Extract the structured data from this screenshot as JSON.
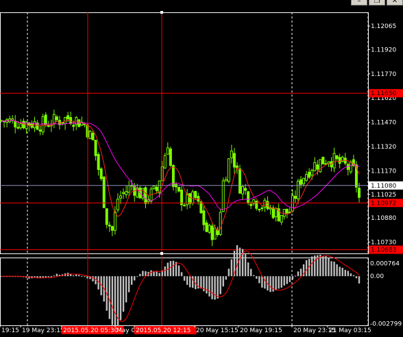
{
  "window": {
    "buttons": [
      {
        "name": "minimize-button",
        "glyph": "–"
      },
      {
        "name": "restore-button",
        "glyph": "❐"
      },
      {
        "name": "close-button",
        "glyph": "✕"
      }
    ]
  },
  "price_axis": {
    "ticks": [
      "1.12065",
      "1.11920",
      "1.11770",
      "1.11620",
      "1.11470",
      "1.11320",
      "1.11170",
      "1.11025",
      "1.10880",
      "1.10730"
    ],
    "bid_tag": "1.11080",
    "hline_tags": [
      "1.11650",
      "1.10972",
      "1.10683"
    ]
  },
  "indicator_axis": {
    "ticks": [
      "0.000764",
      "0.00",
      "-0.002799"
    ]
  },
  "time_axis": {
    "labels": [
      "19:15",
      "19 May 23:15",
      "2015.05.20 05:30",
      "May 0",
      "2015.05.20 12:15",
      "20 May 15:15",
      "20 May 19:15",
      "20 May 23:15",
      "21 May 03:15"
    ],
    "tagged": [
      false,
      false,
      true,
      false,
      true,
      false,
      false,
      false,
      false
    ]
  },
  "colors": {
    "background": "#000000",
    "candles": "#7cfc00",
    "ma_fast": "#ff2020",
    "ma_slow": "#ff00ff",
    "hlines": "#ff0000",
    "vlines": "#ff0000",
    "bid_line": "#9090c0",
    "histogram": "#c0c0c0",
    "signal": "#ff0000",
    "grid": "#ffffff"
  },
  "chart_data": {
    "type": "candlestick",
    "symbol_scale": "price",
    "ylim": [
      1.1066,
      1.1215
    ],
    "horizontal_lines": [
      1.1165,
      1.10972,
      1.10683
    ],
    "bid": 1.1108,
    "indicator": {
      "type": "macd",
      "ylim": [
        -0.0029,
        0.0011
      ],
      "ticks": [
        0.000764,
        0.0,
        -0.002799
      ]
    }
  }
}
